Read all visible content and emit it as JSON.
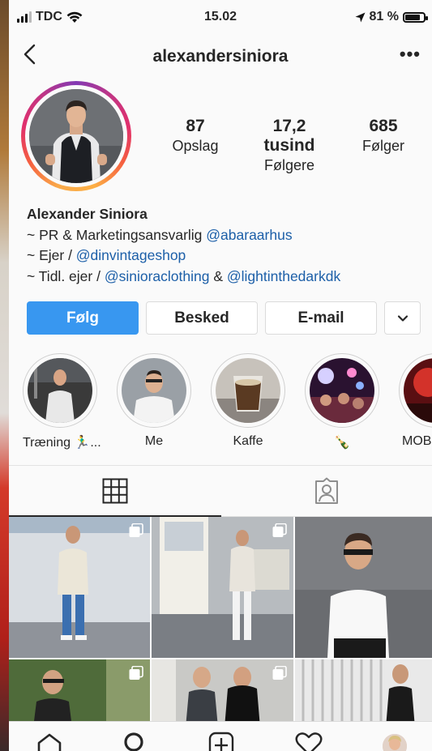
{
  "status_bar": {
    "carrier": "TDC",
    "time": "15.02",
    "battery": "81 %",
    "battery_level": 0.81
  },
  "header": {
    "username": "alexandersiniora"
  },
  "profile": {
    "stats": [
      {
        "value": "87",
        "label": "Opslag"
      },
      {
        "value": "17,2 tusind",
        "label": "Følgere"
      },
      {
        "value": "685",
        "label": "Følger"
      }
    ],
    "name": "Alexander Siniora",
    "bio": {
      "line1_prefix": "~ PR & Marketingsansvarlig ",
      "line1_link": "@abaraarhus",
      "line2_prefix": "~ Ejer / ",
      "line2_link": "@dinvintageshop",
      "line3_prefix": "~ Tidl. ejer / ",
      "line3_link1": "@sinioraclothing",
      "line3_mid": " & ",
      "line3_link2": "@lightinthedarkdk"
    }
  },
  "actions": {
    "follow": "Følg",
    "message": "Besked",
    "email": "E-mail"
  },
  "highlights": [
    {
      "label": "Træning 🏃‍♂️..."
    },
    {
      "label": "Me"
    },
    {
      "label": "Kaffe"
    },
    {
      "label": "🍾"
    },
    {
      "label": "MOBIL"
    }
  ],
  "icons": {
    "back": "chevron-left-icon",
    "more": "more-icon",
    "grid": "grid-icon",
    "tagged": "tagged-icon",
    "home": "home-icon",
    "search": "search-icon",
    "add": "add-icon",
    "activity": "heart-icon",
    "profile": "avatar"
  },
  "colors": {
    "accent": "#3897f0",
    "link": "#1c5fa8"
  }
}
